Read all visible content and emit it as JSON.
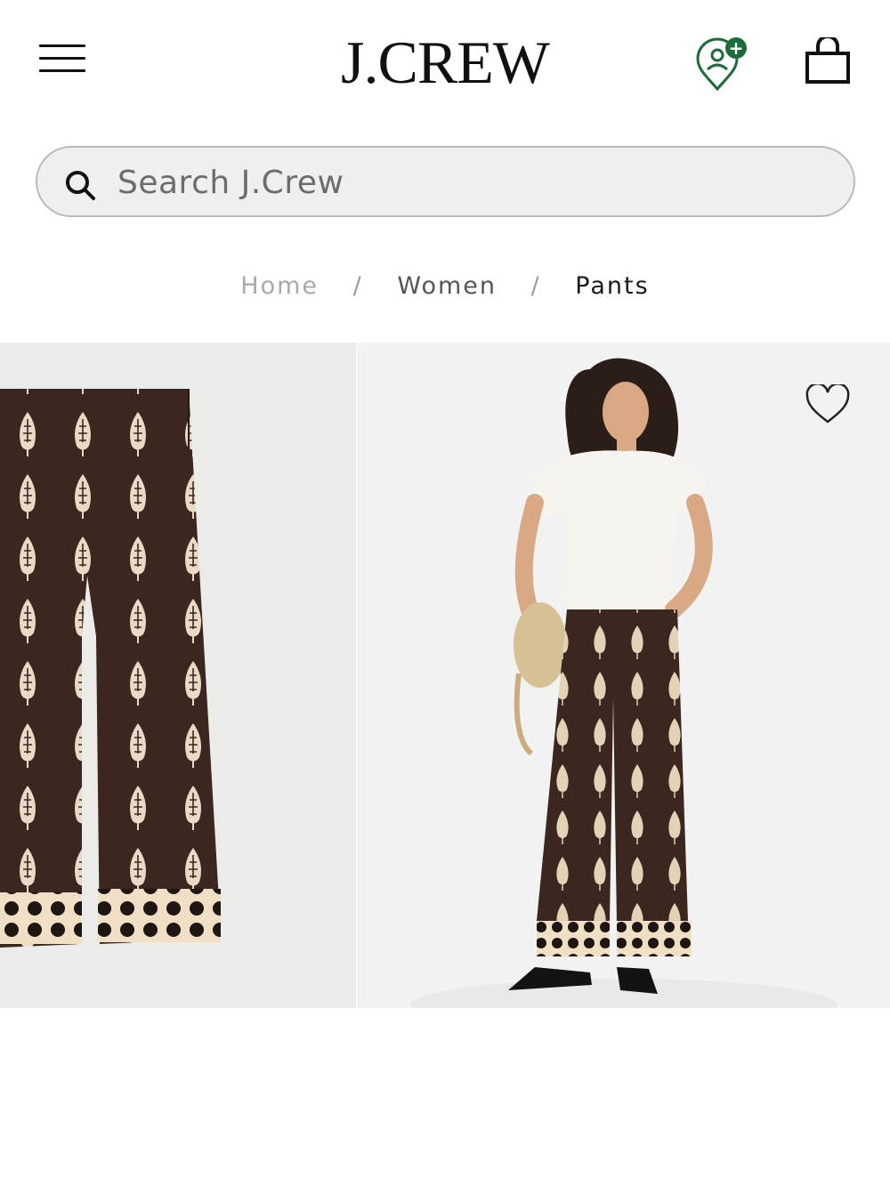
{
  "header": {
    "logo_text": "J.CREW",
    "menu_icon": "hamburger-menu-icon",
    "rewards_icon": "rewards-location-icon",
    "rewards_badge": "+",
    "bag_icon": "shopping-bag-icon"
  },
  "search": {
    "placeholder": "Search J.Crew",
    "icon": "search-icon"
  },
  "breadcrumb": {
    "items": [
      {
        "label": "Home"
      },
      {
        "label": "Women"
      },
      {
        "label": "Pants"
      }
    ],
    "separator": "/"
  },
  "gallery": {
    "images": [
      {
        "name": "flat-lay-pants-image"
      },
      {
        "name": "model-wearing-pants-image"
      }
    ],
    "wishlist_icon": "heart-icon"
  },
  "colors": {
    "brand_green": "#1e6b3a",
    "pants_brown": "#3b2620",
    "pattern_cream": "#efdcc0"
  }
}
